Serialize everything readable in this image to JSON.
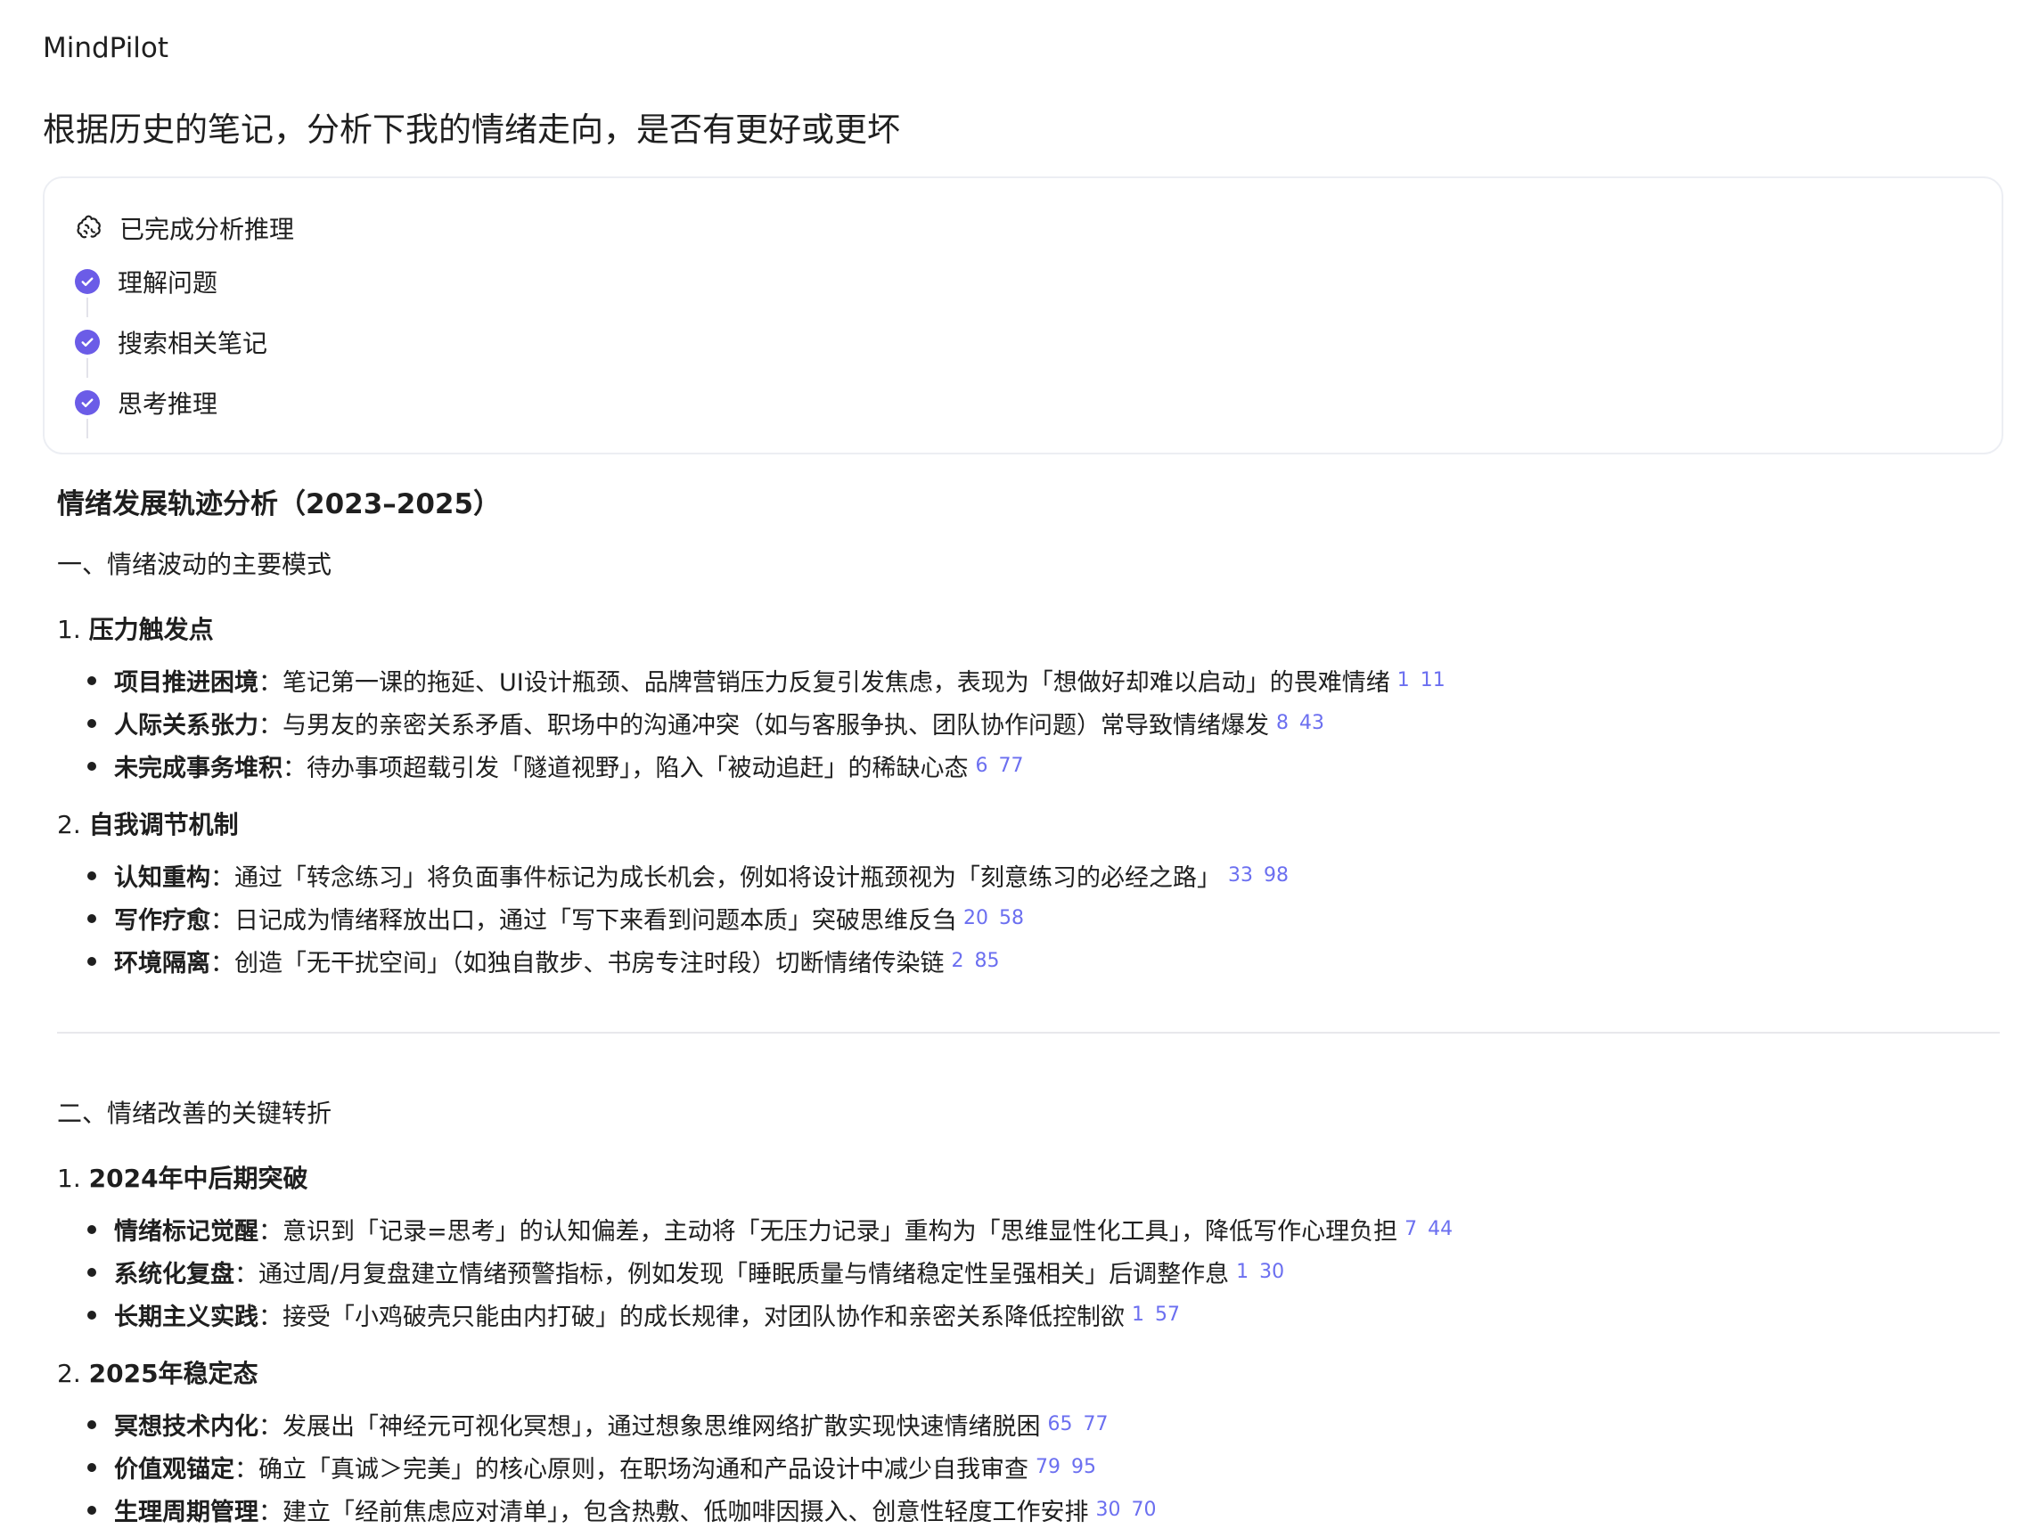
{
  "app": {
    "name": "MindPilot"
  },
  "query": "根据历史的笔记，分析下我的情绪走向，是否有更好或更坏",
  "reasoning": {
    "title": "已完成分析推理",
    "icon": "brain-icon",
    "steps": [
      {
        "label": "理解问题",
        "status": "done"
      },
      {
        "label": "搜索相关笔记",
        "status": "done"
      },
      {
        "label": "思考推理",
        "status": "done"
      }
    ]
  },
  "analysis": {
    "title": "情绪发展轨迹分析（2023–2025）",
    "sections": [
      {
        "heading": "一、情绪波动的主要模式",
        "groups": [
          {
            "num": "1.",
            "title": "压力触发点",
            "items": [
              {
                "term": "项目推进困境",
                "text": "：笔记第一课的拖延、UI设计瓶颈、品牌营销压力反复引发焦虑，表现为「想做好却难以启动」的畏难情绪",
                "cites": [
                  "1",
                  "11"
                ]
              },
              {
                "term": "人际关系张力",
                "text": "：与男友的亲密关系矛盾、职场中的沟通冲突（如与客服争执、团队协作问题）常导致情绪爆发",
                "cites": [
                  "8",
                  "43"
                ]
              },
              {
                "term": "未完成事务堆积",
                "text": "：待办事项超载引发「隧道视野」，陷入「被动追赶」的稀缺心态",
                "cites": [
                  "6",
                  "77"
                ]
              }
            ]
          },
          {
            "num": "2.",
            "title": "自我调节机制",
            "items": [
              {
                "term": "认知重构",
                "text": "：通过「转念练习」将负面事件标记为成长机会，例如将设计瓶颈视为「刻意练习的必经之路」",
                "cites": [
                  "33",
                  "98"
                ]
              },
              {
                "term": "写作疗愈",
                "text": "：日记成为情绪释放出口，通过「写下来看到问题本质」突破思维反刍",
                "cites": [
                  "20",
                  "58"
                ]
              },
              {
                "term": "环境隔离",
                "text": "：创造「无干扰空间」（如独自散步、书房专注时段）切断情绪传染链",
                "cites": [
                  "2",
                  "85"
                ]
              }
            ]
          }
        ]
      },
      {
        "heading": "二、情绪改善的关键转折",
        "groups": [
          {
            "num": "1.",
            "title": "2024年中后期突破",
            "items": [
              {
                "term": "情绪标记觉醒",
                "text": "：意识到「记录=思考」的认知偏差，主动将「无压力记录」重构为「思维显性化工具」，降低写作心理负担",
                "cites": [
                  "7",
                  "44"
                ]
              },
              {
                "term": "系统化复盘",
                "text": "：通过周/月复盘建立情绪预警指标，例如发现「睡眠质量与情绪稳定性呈强相关」后调整作息",
                "cites": [
                  "1",
                  "30"
                ]
              },
              {
                "term": "长期主义实践",
                "text": "：接受「小鸡破壳只能由内打破」的成长规律，对团队协作和亲密关系降低控制欲",
                "cites": [
                  "1",
                  "57"
                ]
              }
            ]
          },
          {
            "num": "2.",
            "title": "2025年稳定态",
            "items": [
              {
                "term": "冥想技术内化",
                "text": "：发展出「神经元可视化冥想」，通过想象思维网络扩散实现快速情绪脱困",
                "cites": [
                  "65",
                  "77"
                ]
              },
              {
                "term": "价值观锚定",
                "text": "：确立「真诚＞完美」的核心原则，在职场沟通和产品设计中减少自我审查",
                "cites": [
                  "79",
                  "95"
                ]
              },
              {
                "term": "生理周期管理",
                "text": "：建立「经前焦虑应对清单」，包含热敷、低咖啡因摄入、创意性轻度工作安排",
                "cites": [
                  "30",
                  "70"
                ]
              }
            ]
          }
        ]
      }
    ]
  },
  "colors": {
    "accent": "#6b5ce7",
    "cite": "#6b6ff0",
    "border": "#eceef3",
    "text": "#1f1f1f"
  }
}
